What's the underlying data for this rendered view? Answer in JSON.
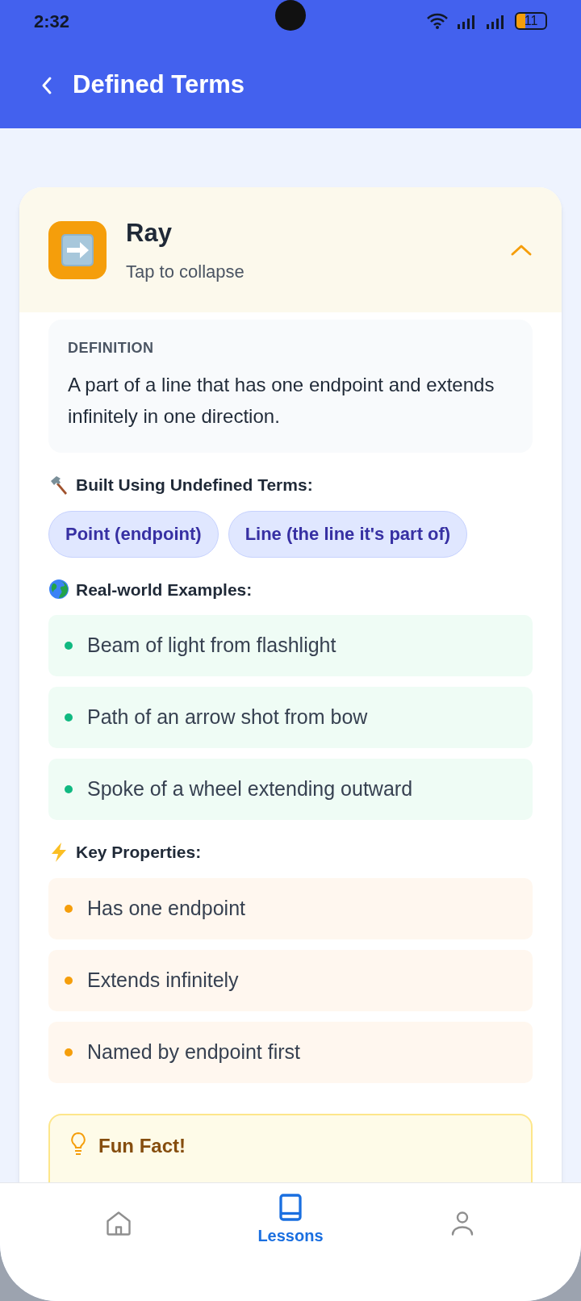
{
  "status_bar": {
    "time": "2:32",
    "battery": "11"
  },
  "header": {
    "title": "Defined Terms"
  },
  "term": {
    "name": "Ray",
    "hint": "Tap to collapse",
    "expanded": true,
    "definition": {
      "label": "DEFINITION",
      "text": "A part of a line that has one endpoint and extends infinitely in one direction."
    },
    "built_using": {
      "kind": "hammer",
      "title": "Built Using Undefined Terms:",
      "chips": [
        "Point (endpoint)",
        "Line (the line it's part of)"
      ]
    },
    "examples": {
      "kind": "globe",
      "title": "Real-world Examples:",
      "items": [
        "Beam of light from flashlight",
        "Path of an arrow shot from bow",
        "Spoke of a wheel extending outward"
      ]
    },
    "properties": {
      "kind": "lightning",
      "title": "Key Properties:",
      "items": [
        "Has one endpoint",
        "Extends infinitely",
        "Named by endpoint first"
      ]
    },
    "fun_fact": {
      "title": "Fun Fact!"
    }
  },
  "nav": [
    {
      "kind": "home",
      "selected": false
    },
    {
      "kind": "lessons",
      "label": "Lessons",
      "selected": true
    },
    {
      "kind": "profile",
      "selected": false
    }
  ]
}
